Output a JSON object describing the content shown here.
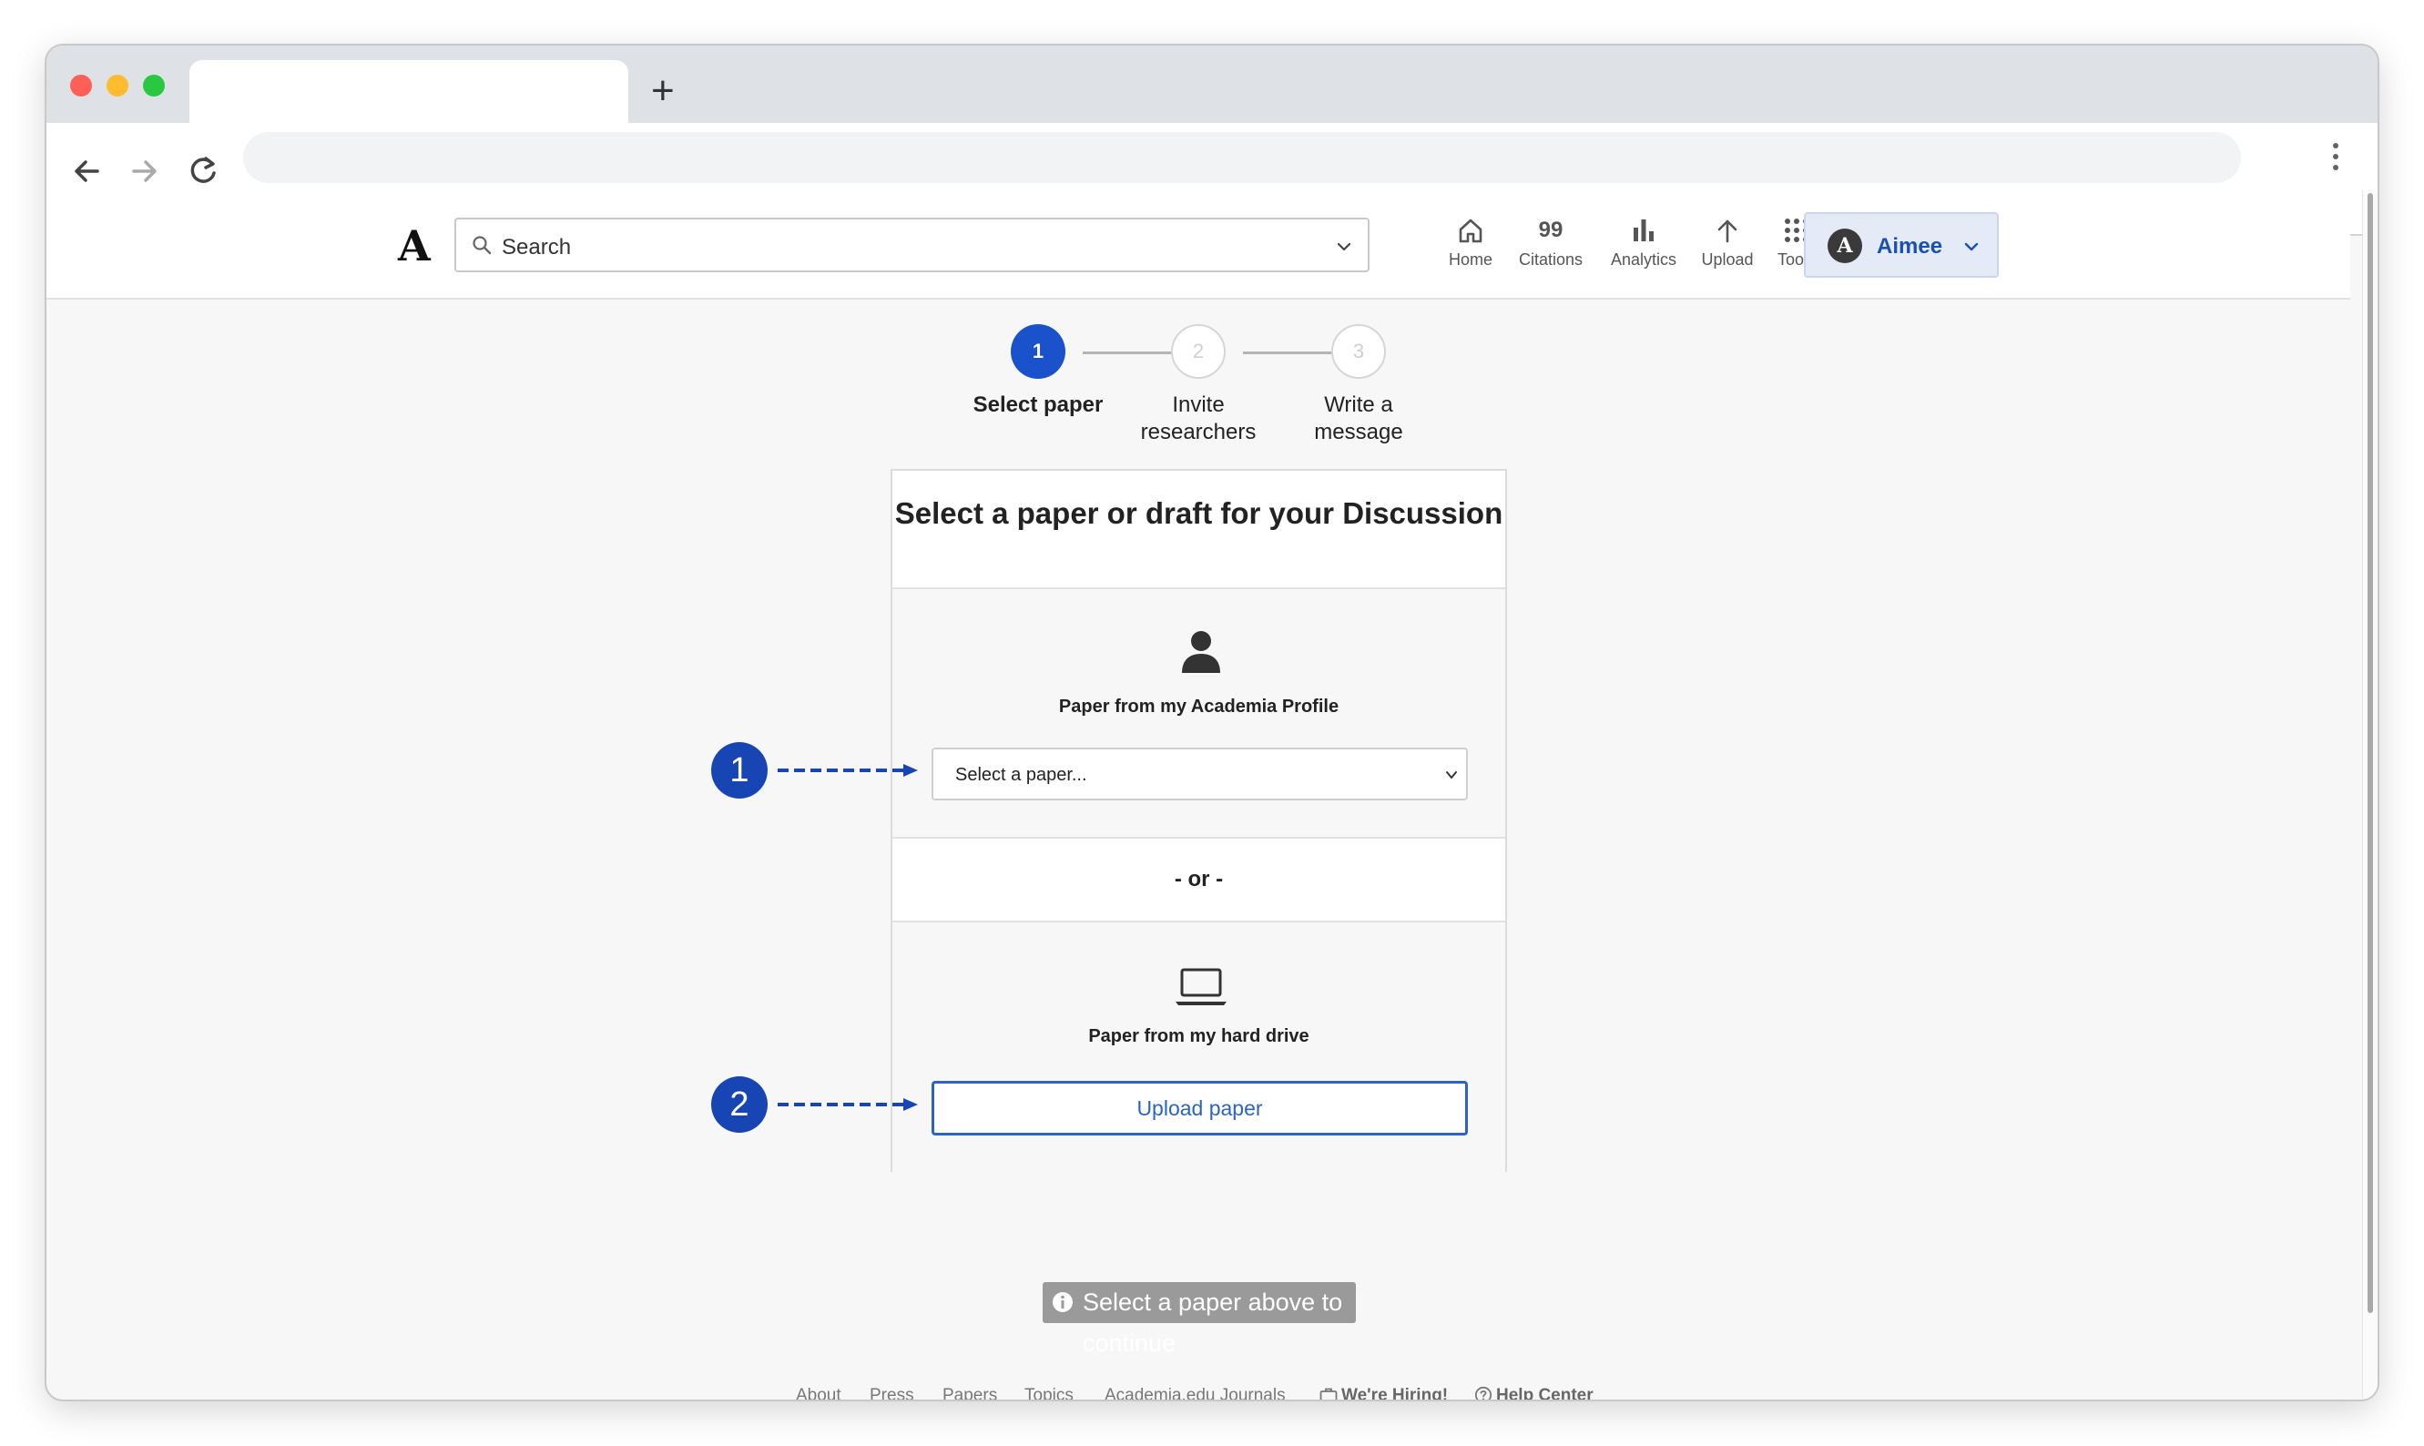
{
  "browser": {
    "new_tab_symbol": "+"
  },
  "header": {
    "logo": "A",
    "search_placeholder": "Search",
    "nav": [
      {
        "icon": "home-icon",
        "label": "Home"
      },
      {
        "icon": "quote-icon",
        "label": "Citations",
        "glyph": "99"
      },
      {
        "icon": "bar-chart-icon",
        "label": "Analytics"
      },
      {
        "icon": "upload-arrow-icon",
        "label": "Upload"
      },
      {
        "icon": "grid-icon",
        "label": "Tools"
      }
    ],
    "user": {
      "avatar_letter": "A",
      "name": "Aimee"
    }
  },
  "stepper": {
    "steps": [
      {
        "number": "1",
        "label_line1": "Select paper",
        "label_line2": "",
        "active": true
      },
      {
        "number": "2",
        "label_line1": "Invite",
        "label_line2": "researchers",
        "active": false
      },
      {
        "number": "3",
        "label_line1": "Write a",
        "label_line2": "message",
        "active": false
      }
    ]
  },
  "card": {
    "title": "Select a paper or draft for your Discussion",
    "profile_section": {
      "icon": "person-icon",
      "label": "Paper from my Academia Profile",
      "select_value": "Select a paper..."
    },
    "separator": "- or -",
    "drive_section": {
      "icon": "laptop-icon",
      "label": "Paper from my hard drive",
      "button_label": "Upload paper"
    }
  },
  "annotations": [
    {
      "number": "1"
    },
    {
      "number": "2"
    }
  ],
  "continue_hint": "Select a paper above to continue",
  "footer": {
    "links": [
      "About",
      "Press",
      "Papers",
      "Topics",
      "Academia.edu Journals"
    ],
    "hiring": "We're Hiring!",
    "help": "Help Center"
  },
  "colors": {
    "accent": "#1a52cc",
    "annotation": "#1746b4",
    "upload_border": "#2b63c6",
    "continue_bg": "#9a9a9a"
  }
}
